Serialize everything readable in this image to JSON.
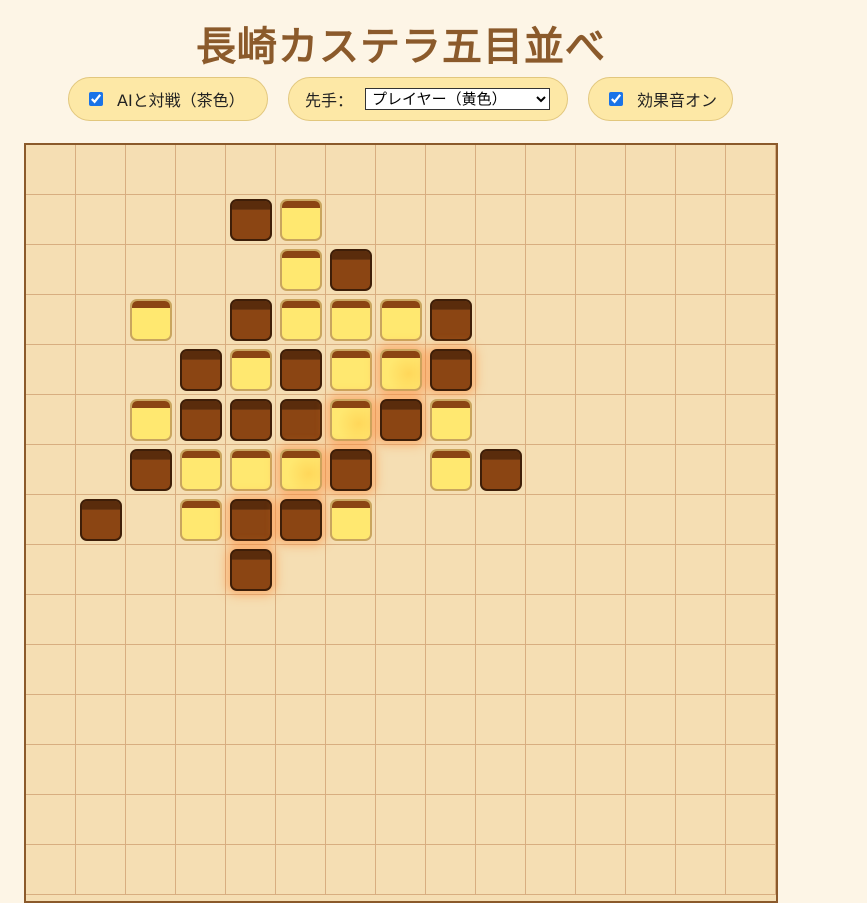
{
  "title": "長崎カステラ五目並べ",
  "controls": {
    "ai_label": "AIと対戦（茶色）",
    "ai_checked": true,
    "first_label": "先手：",
    "first_selected": "プレイヤー（黄色）",
    "sound_label": "効果音オン",
    "sound_checked": true
  },
  "board": {
    "size": 15,
    "colors": {
      "background": "#f5deb3",
      "grid": "#d8ae80",
      "brown_piece": "#8b4513",
      "yellow_piece": "#ffe870",
      "highlight": "#ff8c3c"
    },
    "pieces": [
      {
        "row": 1,
        "col": 4,
        "color": "brown"
      },
      {
        "row": 1,
        "col": 5,
        "color": "yellow"
      },
      {
        "row": 2,
        "col": 5,
        "color": "yellow"
      },
      {
        "row": 2,
        "col": 6,
        "color": "brown"
      },
      {
        "row": 3,
        "col": 2,
        "color": "yellow"
      },
      {
        "row": 3,
        "col": 4,
        "color": "brown"
      },
      {
        "row": 3,
        "col": 5,
        "color": "yellow"
      },
      {
        "row": 3,
        "col": 6,
        "color": "yellow"
      },
      {
        "row": 3,
        "col": 7,
        "color": "yellow"
      },
      {
        "row": 3,
        "col": 8,
        "color": "brown"
      },
      {
        "row": 4,
        "col": 3,
        "color": "brown"
      },
      {
        "row": 4,
        "col": 4,
        "color": "yellow"
      },
      {
        "row": 4,
        "col": 5,
        "color": "brown"
      },
      {
        "row": 4,
        "col": 6,
        "color": "yellow"
      },
      {
        "row": 4,
        "col": 7,
        "color": "yellow",
        "highlight": true
      },
      {
        "row": 4,
        "col": 8,
        "color": "brown",
        "highlight": true
      },
      {
        "row": 5,
        "col": 2,
        "color": "yellow"
      },
      {
        "row": 5,
        "col": 3,
        "color": "brown"
      },
      {
        "row": 5,
        "col": 4,
        "color": "brown"
      },
      {
        "row": 5,
        "col": 5,
        "color": "brown"
      },
      {
        "row": 5,
        "col": 6,
        "color": "yellow",
        "highlight": true
      },
      {
        "row": 5,
        "col": 7,
        "color": "brown",
        "highlight": true
      },
      {
        "row": 5,
        "col": 8,
        "color": "yellow"
      },
      {
        "row": 6,
        "col": 2,
        "color": "brown"
      },
      {
        "row": 6,
        "col": 3,
        "color": "yellow"
      },
      {
        "row": 6,
        "col": 4,
        "color": "yellow"
      },
      {
        "row": 6,
        "col": 5,
        "color": "yellow",
        "highlight": true
      },
      {
        "row": 6,
        "col": 6,
        "color": "brown",
        "highlight": true
      },
      {
        "row": 6,
        "col": 8,
        "color": "yellow"
      },
      {
        "row": 6,
        "col": 9,
        "color": "brown"
      },
      {
        "row": 7,
        "col": 1,
        "color": "brown"
      },
      {
        "row": 7,
        "col": 3,
        "color": "yellow"
      },
      {
        "row": 7,
        "col": 4,
        "color": "brown",
        "highlight": true
      },
      {
        "row": 7,
        "col": 5,
        "color": "brown",
        "highlight": true
      },
      {
        "row": 7,
        "col": 6,
        "color": "yellow"
      },
      {
        "row": 8,
        "col": 4,
        "color": "brown",
        "highlight": true
      }
    ]
  }
}
